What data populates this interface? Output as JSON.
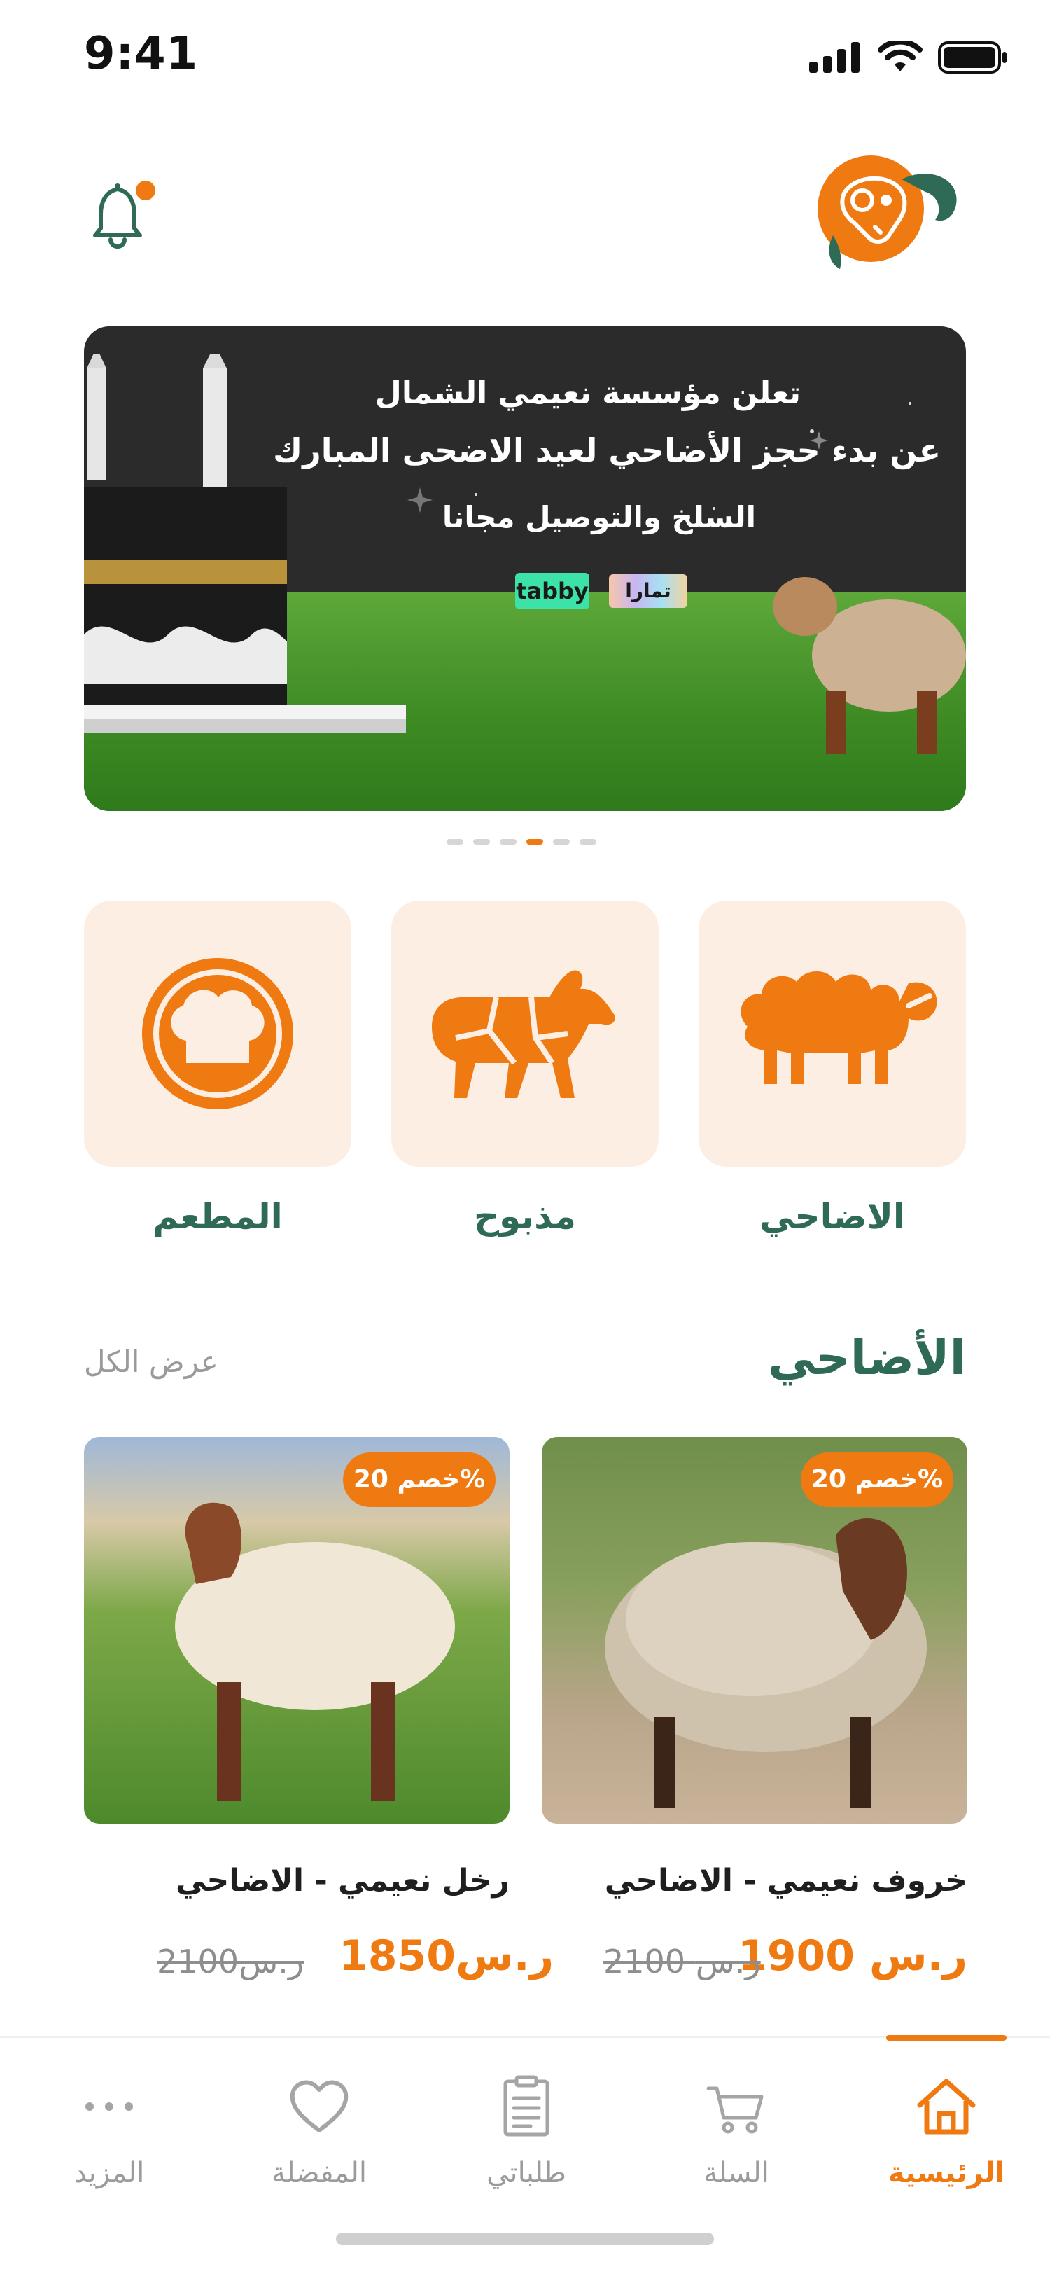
{
  "status": {
    "time": "9:41"
  },
  "banner": {
    "line1": "تعلن مؤسسة نعيمي الشمال",
    "line2": "عن بدء حجز الأضاحي لعيد الاضحى المبارك",
    "line3": "السلخ والتوصيل مجانا",
    "tabby": "tabby",
    "tamara": "تمارا"
  },
  "carousel": {
    "count": 6,
    "active": 4
  },
  "categories": [
    {
      "label": "الاضاحي",
      "icon": "sheep-icon"
    },
    {
      "label": "مذبوح",
      "icon": "meat-cuts-icon"
    },
    {
      "label": "المطعم",
      "icon": "chef-hat-icon"
    }
  ],
  "section": {
    "title": "الأضاحي",
    "view_all": "عرض الكل"
  },
  "products": [
    {
      "badge": "خصم 20%",
      "title": "خروف نعيمي - الاضاحي",
      "price": "1900 ر.س",
      "old_price": "2100 ر.س"
    },
    {
      "badge": "خصم 20%",
      "title": "رخل نعيمي - الاضاحي",
      "price": "1850ر.س",
      "old_price": "2100ر.س"
    }
  ],
  "tabs": [
    {
      "label": "الرئيسية",
      "icon": "home-icon",
      "active": true
    },
    {
      "label": "السلة",
      "icon": "cart-icon"
    },
    {
      "label": "طلباتي",
      "icon": "orders-icon"
    },
    {
      "label": "المفضلة",
      "icon": "heart-icon"
    },
    {
      "label": "المزيد",
      "icon": "more-icon"
    }
  ],
  "colors": {
    "accent": "#f07a12",
    "brand_green": "#2e6a55",
    "card_bg": "#fdeee3"
  }
}
